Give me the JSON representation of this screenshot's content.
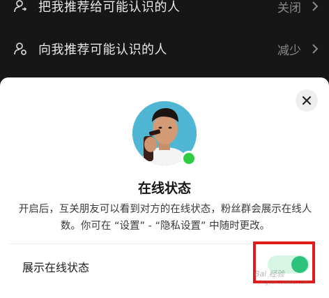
{
  "background_rows": [
    {
      "label": "把我推荐给可能认识的人",
      "value": "关闭"
    },
    {
      "label": "向我推荐可能认识的人",
      "value": "减少"
    }
  ],
  "sheet": {
    "title": "在线状态",
    "description": "开启后，互关朋友可以看到对方的在线状态，粉丝群会展示在线人数。你可在 “设置” - “隐私设置” 中随时更改。",
    "toggle_label": "展示在线状态",
    "toggle_on": true
  },
  "watermark": {
    "text": "Bai 经验",
    "url": "jingyan.baidu.com"
  },
  "colors": {
    "online_dot": "#2ecc40",
    "toggle_knob": "#2fc27a",
    "toggle_track": "#d7f5e4",
    "highlight": "#e01b1b"
  },
  "icons": {
    "row_1": "person-share-icon",
    "row_2": "person-recommend-icon",
    "close": "close-icon",
    "chevron": "chevron-right-icon"
  }
}
